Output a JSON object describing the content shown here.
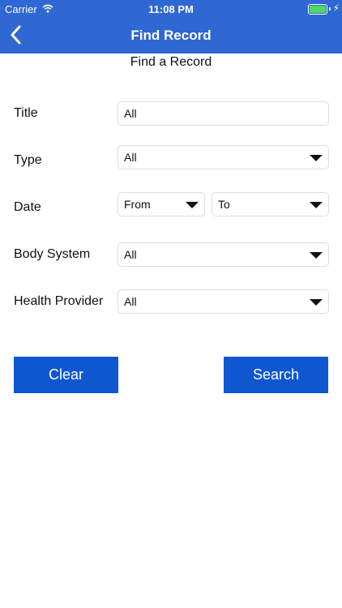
{
  "status_bar": {
    "carrier": "Carrier",
    "time": "11:08 PM"
  },
  "nav": {
    "title": "Find Record"
  },
  "page": {
    "heading": "Find a Record"
  },
  "form": {
    "title": {
      "label": "Title",
      "value": "All"
    },
    "type": {
      "label": "Type",
      "value": "All"
    },
    "date": {
      "label": "Date",
      "from": "From",
      "to": "To"
    },
    "body_system": {
      "label": "Body System",
      "value": "All"
    },
    "health_provider": {
      "label": "Health Provider",
      "value": "All"
    }
  },
  "buttons": {
    "clear": "Clear",
    "search": "Search"
  },
  "colors": {
    "nav_bg": "#2f67d3",
    "button_bg": "#0f57d1",
    "battery": "#4cd964"
  },
  "icons": [
    "wifi-icon",
    "battery-icon",
    "back-chevron-icon",
    "dropdown-caret-icon"
  ]
}
